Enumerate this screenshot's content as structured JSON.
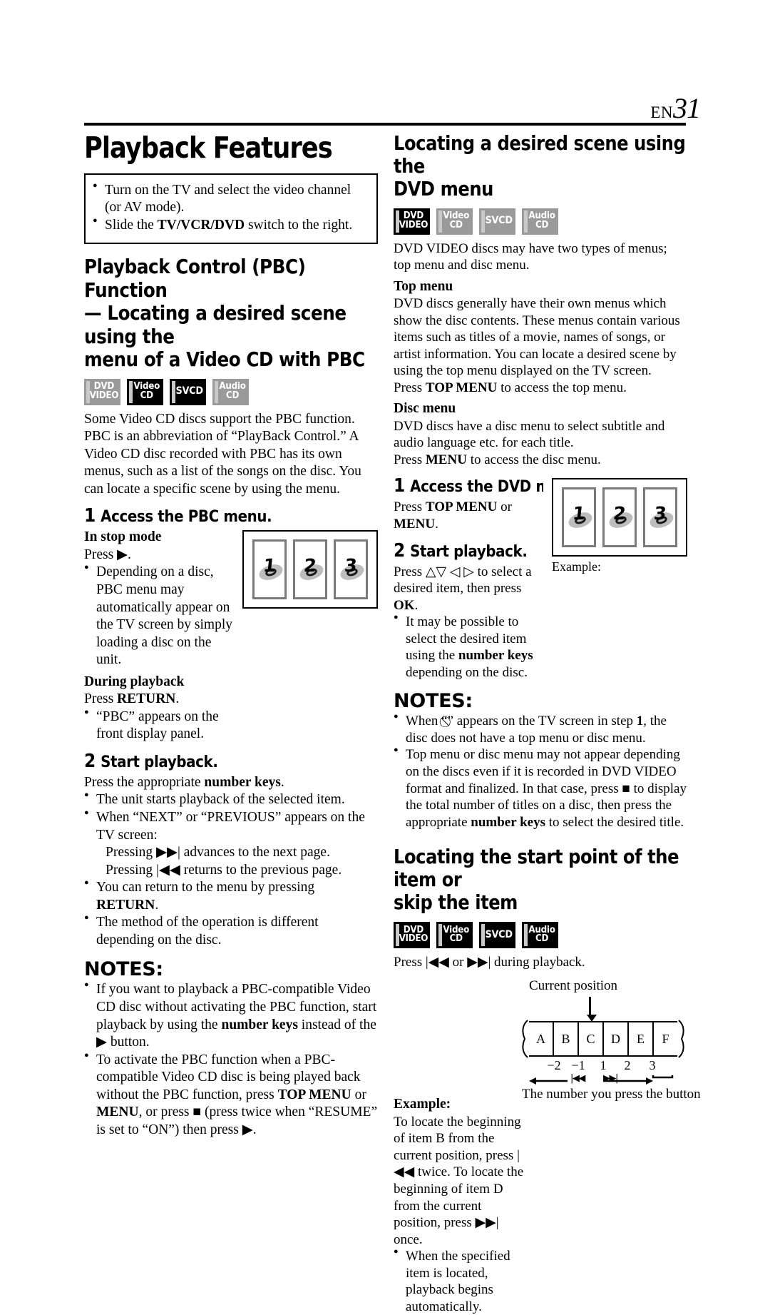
{
  "header": {
    "lang_code": "EN",
    "page_number": "31"
  },
  "left_column": {
    "page_title": "Playback Features",
    "intro_box": {
      "bullets": [
        "Turn on the TV and select the video channel (or AV mode).",
        "Slide the TV/VCR/DVD switch to the right."
      ],
      "bullet2_pre": "Slide the ",
      "bullet2_bold": "TV/VCR/DVD",
      "bullet2_post": " switch to the right."
    },
    "section_heading_line1": "Playback Control (PBC) Function",
    "section_heading_line2": "— Locating a desired scene using the",
    "section_heading_line3": "menu of a Video CD with PBC",
    "badges": [
      {
        "label_line1": "DVD",
        "label_line2": "VIDEO",
        "active": false
      },
      {
        "label_line1": "Video",
        "label_line2": "CD",
        "active": true
      },
      {
        "label_line1": "SVCD",
        "label_line2": "",
        "active": true
      },
      {
        "label_line1": "Audio",
        "label_line2": "CD",
        "active": false
      }
    ],
    "intro_paragraph": "Some Video CD discs support the PBC function. PBC is an abbreviation of “PlayBack Control.” A Video CD disc recorded with PBC has its own menus, such as a list of the songs on the disc. You can locate a specific scene by using the menu.",
    "step1": {
      "number": "1",
      "title": "Access the PBC menu.",
      "sub1_heading": "In stop mode",
      "sub1_line": "Press ▶.",
      "sub1_bullet": "Depending on a disc, PBC menu may automatically appear on the TV screen by simply loading a disc on the unit.",
      "sub2_heading": "During playback",
      "sub2_line_pre": "Press ",
      "sub2_line_bold": "RETURN",
      "sub2_line_post": ".",
      "sub2_bullet": "“PBC” appears on the front display panel."
    },
    "illustration": {
      "panels": [
        "1",
        "2",
        "3"
      ]
    },
    "step2": {
      "number": "2",
      "title": "Start playback.",
      "lead_pre": "Press the appropriate ",
      "lead_bold": "number keys",
      "lead_post": ".",
      "bullets": [
        "The unit starts playback of the selected item.",
        "When “NEXT” or “PREVIOUS” appears on the TV screen:",
        "You can return to the menu by pressing RETURN.",
        "The method of the operation is different depending on the disc."
      ],
      "next_line": "Pressing ▶▶| advances to the next page.",
      "prev_line": "Pressing |◀◀ returns to the previous page.",
      "return_pre": "You can return to the menu by pressing ",
      "return_bold": "RETURN",
      "return_post": "."
    },
    "notes": {
      "heading": "NOTES:",
      "note1_a": "If you want to playback a PBC-compatible Video CD disc without activating the PBC function, start playback by using the ",
      "note1_b": "number keys",
      "note1_c": " instead of the ▶ button.",
      "note2_a": "To activate the PBC function when a PBC-compatible Video CD disc is being played back without the PBC function, press ",
      "note2_b": "TOP MENU",
      "note2_c": " or ",
      "note2_d": "MENU",
      "note2_e": ", or press ■ (press twice when “RESUME” is set to “ON”) then press ▶."
    }
  },
  "right_column": {
    "section1": {
      "heading_line1": "Locating a desired scene using the",
      "heading_line2": "DVD menu",
      "badges": [
        {
          "label_line1": "DVD",
          "label_line2": "VIDEO",
          "active": true
        },
        {
          "label_line1": "Video",
          "label_line2": "CD",
          "active": false
        },
        {
          "label_line1": "SVCD",
          "label_line2": "",
          "active": false
        },
        {
          "label_line1": "Audio",
          "label_line2": "CD",
          "active": false
        }
      ],
      "intro": "DVD VIDEO discs may have two types of menus; top menu and disc menu.",
      "top_menu_heading": "Top menu",
      "top_menu_body": "DVD discs generally have their own menus which show the disc contents. These menus contain various items such as titles of a movie, names of songs, or artist information. You can locate a desired scene by using the top menu displayed on the TV screen.",
      "top_menu_press_pre": "Press ",
      "top_menu_press_bold": "TOP MENU",
      "top_menu_press_post": " to access the top menu.",
      "disc_menu_heading": "Disc menu",
      "disc_menu_body": "DVD discs have a disc menu to select subtitle and audio language etc. for each title.",
      "disc_menu_press_pre": "Press ",
      "disc_menu_press_bold": "MENU",
      "disc_menu_press_post": " to access the disc menu.",
      "step1": {
        "number": "1",
        "title": "Access the DVD menu.",
        "line_pre": "Press ",
        "line_b1": "TOP MENU",
        "line_mid": " or ",
        "line_b2": "MENU",
        "line_post": "."
      },
      "step2": {
        "number": "2",
        "title": "Start playback.",
        "line_pre": "Press △▽ ◁ ▷ to select a desired item, then press ",
        "line_bold": "OK",
        "line_post": ".",
        "bullet_a": "It may be possible to select the desired item using the ",
        "bullet_b": "number keys",
        "bullet_c": " depending on the disc."
      },
      "illustration": {
        "panels": [
          "1",
          "2",
          "3"
        ],
        "caption": "Example:"
      },
      "notes": {
        "heading": "NOTES:",
        "note1_a": "When “",
        "note1_sym": "⃠",
        "note1_b": "” appears on the TV screen in step ",
        "note1_bold": "1",
        "note1_c": ", the disc does not have a top menu or disc menu.",
        "note2_a": "Top menu or disc menu may not appear depending on the discs even if it is recorded in DVD VIDEO format and finalized. In that case, press ■ to display the total number of titles on a disc, then press the appropriate ",
        "note2_b": "number keys",
        "note2_c": " to select the desired title."
      }
    },
    "section2": {
      "heading_line1": "Locating the start point of the item or",
      "heading_line2": "skip the item",
      "badges": [
        {
          "label_line1": "DVD",
          "label_line2": "VIDEO",
          "active": true
        },
        {
          "label_line1": "Video",
          "label_line2": "CD",
          "active": true
        },
        {
          "label_line1": "SVCD",
          "label_line2": "",
          "active": true
        },
        {
          "label_line1": "Audio",
          "label_line2": "CD",
          "active": true
        }
      ],
      "press_line": "Press |◀◀ or ▶▶| during playback.",
      "example_heading": "Example:",
      "example_body": "To locate the beginning of item B from the current position, press |◀◀ twice. To locate the beginning of item D from the current position, press ▶▶| once.",
      "example_bullet": "When the specified item is located, playback begins automatically.",
      "diagram": {
        "current_position_label": "Current position",
        "items": [
          "A",
          "B",
          "C",
          "D",
          "E",
          "F"
        ],
        "scale_numbers": [
          "−2",
          "−1",
          "1",
          "2",
          "3"
        ],
        "back_symbol": "|◀◀",
        "forward_symbol": "▶▶|",
        "footer_label": "The number you press the button"
      }
    }
  }
}
